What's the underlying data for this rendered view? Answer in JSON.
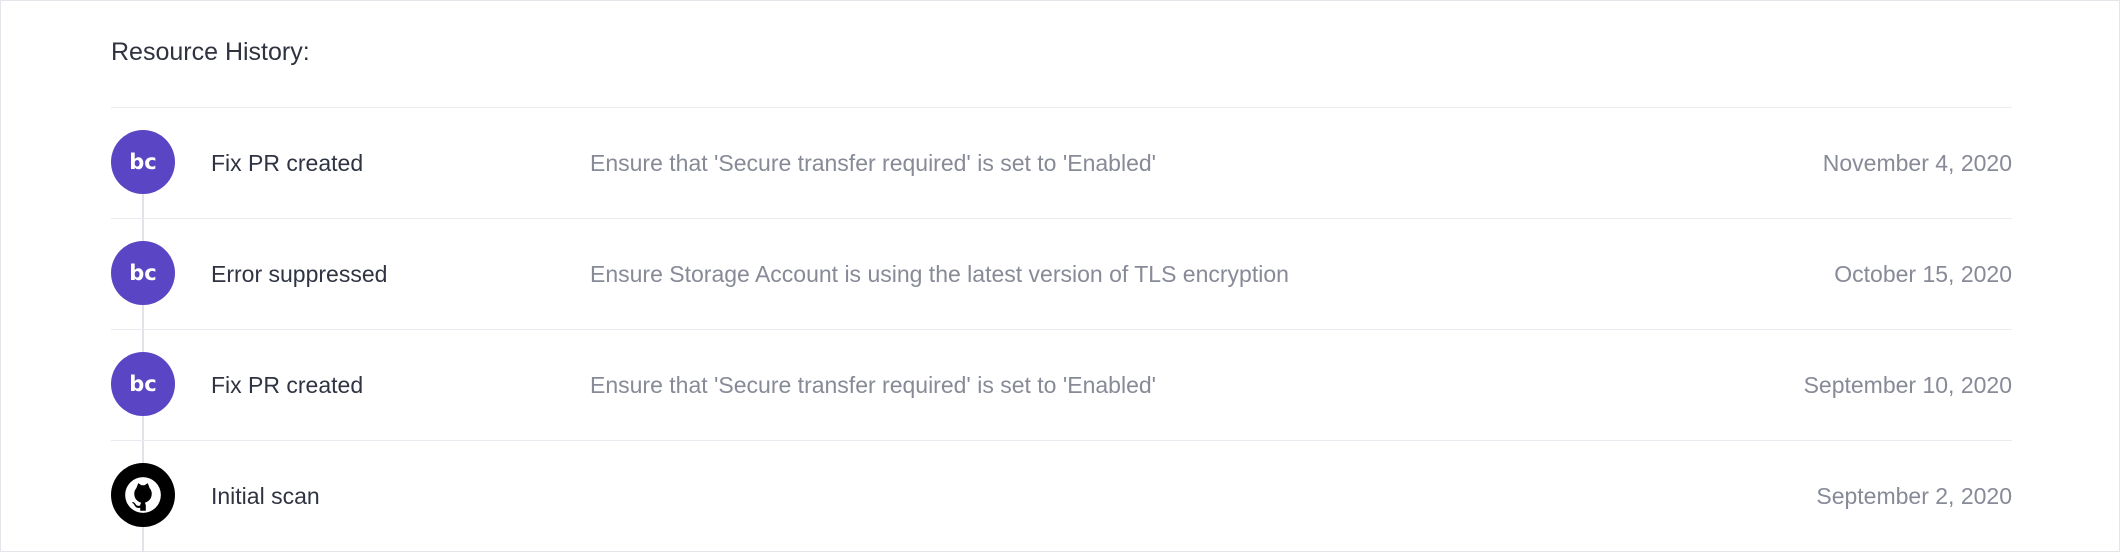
{
  "section": {
    "title": "Resource History:"
  },
  "history": [
    {
      "event": "Fix PR created",
      "description": "Ensure that 'Secure transfer required' is set to 'Enabled'",
      "date": "November 4, 2020",
      "icon": "bridgecrew-logo-icon"
    },
    {
      "event": "Error suppressed",
      "description": "Ensure Storage Account is using the latest version of TLS encryption",
      "date": "October 15, 2020",
      "icon": "bridgecrew-logo-icon"
    },
    {
      "event": "Fix PR created",
      "description": "Ensure that 'Secure transfer required' is set to 'Enabled'",
      "date": "September 10, 2020",
      "icon": "bridgecrew-logo-icon"
    },
    {
      "event": "Initial scan",
      "description": "",
      "date": "September 2, 2020",
      "icon": "github-logo-icon"
    }
  ],
  "colors": {
    "brand": "#5a45c4",
    "github": "#000000",
    "muted_text": "#878a97",
    "divider": "#e9ebf0"
  }
}
